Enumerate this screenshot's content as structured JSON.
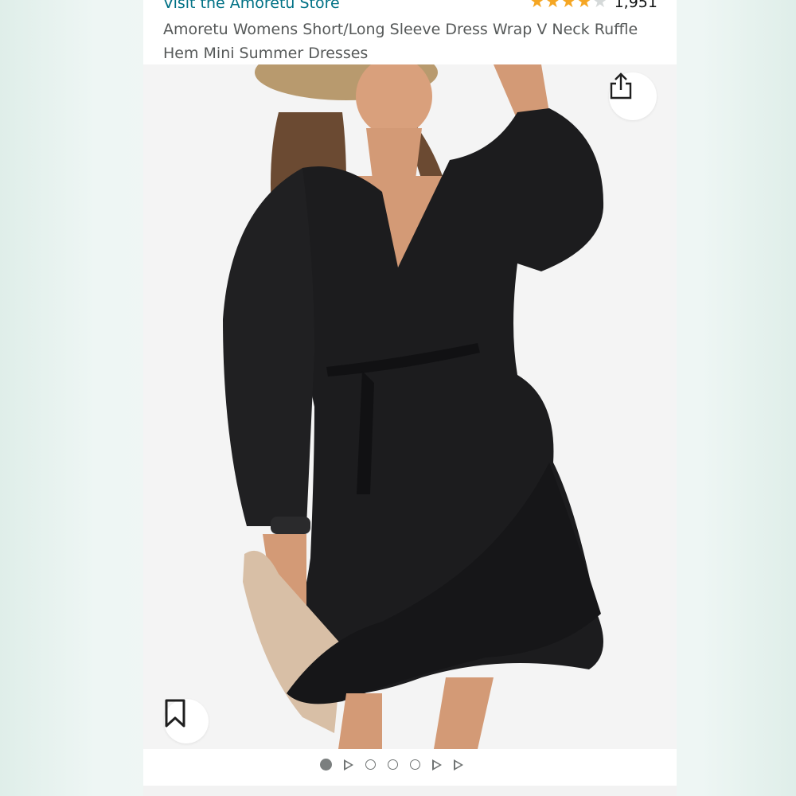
{
  "product": {
    "store_link": "Visit the Amoretu Store",
    "rating_count": "1,951",
    "rating_stars": 4,
    "title": "Amoretu Womens Short/Long Sleeve Dress Wrap V Neck Ruffle Hem Mini Summer Dresses"
  },
  "gallery": {
    "image_alt": "Woman wearing black long sleeve wrap dress with ruffle hem, straw hat and beige clutch",
    "share_icon": "share-icon",
    "save_icon": "bookmark-icon",
    "indicators": [
      "image",
      "video",
      "image",
      "image",
      "image",
      "video",
      "video"
    ],
    "active_index": 0
  },
  "colors": {
    "link": "#007185",
    "star": "#f5a623",
    "text": "#565959"
  }
}
